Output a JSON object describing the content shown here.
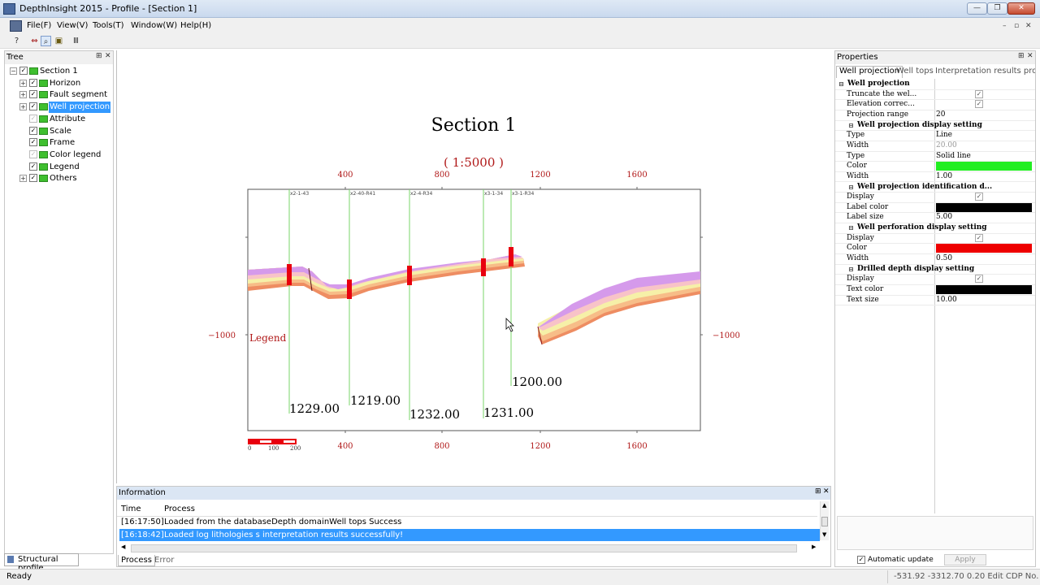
{
  "window": {
    "title": "DepthInsight 2015 - Profile - [Section 1]",
    "controls": [
      "—",
      "❐",
      "✕"
    ]
  },
  "menu": [
    {
      "label": "File(F)"
    },
    {
      "label": "View(V)"
    },
    {
      "label": "Tools(T)"
    },
    {
      "label": "Window(W)"
    },
    {
      "label": "Help(H)"
    }
  ],
  "mdi_controls": [
    "–",
    "▫",
    "✕"
  ],
  "toolbar": [
    "?",
    "⇔",
    "⌕",
    "▣",
    "Ⅲ"
  ],
  "tree": {
    "title": "Tree",
    "pin": "⊞",
    "close": "✕",
    "items": [
      {
        "label": "Section 1",
        "level": 0,
        "expander": "−",
        "checked": true,
        "faded": false
      },
      {
        "label": "Horizon",
        "level": 1,
        "expander": "+",
        "checked": true,
        "faded": false
      },
      {
        "label": "Fault segment",
        "level": 1,
        "expander": "+",
        "checked": true,
        "faded": false
      },
      {
        "label": "Well projection",
        "level": 1,
        "expander": "+",
        "checked": true,
        "faded": false,
        "selected": true
      },
      {
        "label": "Attribute",
        "level": 1,
        "expander": "",
        "checked": true,
        "faded": true
      },
      {
        "label": "Scale",
        "level": 1,
        "expander": "",
        "checked": true,
        "faded": false
      },
      {
        "label": "Frame",
        "level": 1,
        "expander": "",
        "checked": true,
        "faded": false
      },
      {
        "label": "Color legend",
        "level": 1,
        "expander": "",
        "checked": true,
        "faded": true
      },
      {
        "label": "Legend",
        "level": 1,
        "expander": "",
        "checked": true,
        "faded": false
      },
      {
        "label": "Others",
        "level": 1,
        "expander": "+",
        "checked": true,
        "faded": false
      }
    ],
    "tab_label": "Structural profile"
  },
  "profile": {
    "title": "Section 1",
    "scale_label": "( 1:5000 )",
    "x_ticks": [
      "400",
      "800",
      "1200",
      "1600"
    ],
    "y_tick": "−1000",
    "legend_label": "Legend",
    "scalebar_labels": [
      "0",
      "100",
      "200"
    ],
    "wells": [
      {
        "name": "x2-1-43",
        "depth": "1229.00"
      },
      {
        "name": "x2-40-R41",
        "depth": "1219.00"
      },
      {
        "name": "x2-4-R34",
        "depth": "1232.00"
      },
      {
        "name": "x3-1-34",
        "depth": "1231.00"
      },
      {
        "name": "x3-1-R34",
        "depth": "1200.00"
      }
    ],
    "colors": {
      "layer_top": "#d59aeb",
      "layer_upper": "#f8c3c8",
      "layer_mid": "#f6f0a8",
      "layer_lower": "#f7bd88",
      "layer_base": "#ee8d62",
      "well_line": "#7ad66a",
      "perforation": "#e8000e",
      "axis_text": "#b01818"
    }
  },
  "information": {
    "title": "Information",
    "pin": "⊞",
    "close": "✕",
    "columns": [
      "Time",
      "Process"
    ],
    "rows": [
      {
        "time": "[16:17:50]",
        "process": "Loaded from the databaseDepth domainWell tops Success",
        "selected": false
      },
      {
        "time": "[16:18:42]",
        "process": "Loaded log lithologies s interpretation results successfully!",
        "selected": true
      }
    ],
    "tabs": [
      "Process",
      "Error"
    ]
  },
  "properties": {
    "title": "Properties",
    "pin": "⊞",
    "close": "✕",
    "tabs": [
      "Well projection",
      "Well tops",
      "Interpretation results pro..."
    ],
    "rows": [
      {
        "type": "group",
        "name": "Well projection"
      },
      {
        "type": "check",
        "name": "Truncate the wel...",
        "value": "✓"
      },
      {
        "type": "check",
        "name": "Elevation correc...",
        "value": "✓"
      },
      {
        "type": "text",
        "name": "Projection range",
        "value": "20"
      },
      {
        "type": "group",
        "name": "Well projection display setting"
      },
      {
        "type": "text",
        "name": "Type",
        "value": "Line"
      },
      {
        "type": "text",
        "name": "Width",
        "value": "20.00",
        "disabled": true
      },
      {
        "type": "text",
        "name": "Type",
        "value": "Solid line"
      },
      {
        "type": "color",
        "name": "Color",
        "value": "#22ee22"
      },
      {
        "type": "text",
        "name": "Width",
        "value": "1.00"
      },
      {
        "type": "group",
        "name": "Well projection identification d..."
      },
      {
        "type": "check",
        "name": "Display",
        "value": "✓"
      },
      {
        "type": "color",
        "name": "Label color",
        "value": "#000000"
      },
      {
        "type": "text",
        "name": "Label size",
        "value": "5.00"
      },
      {
        "type": "group",
        "name": "Well perforation display setting"
      },
      {
        "type": "check",
        "name": "Display",
        "value": "✓"
      },
      {
        "type": "color",
        "name": "Color",
        "value": "#ee0000"
      },
      {
        "type": "text",
        "name": "Width",
        "value": "0.50"
      },
      {
        "type": "group",
        "name": "Drilled depth display setting"
      },
      {
        "type": "check",
        "name": "Display",
        "value": "✓"
      },
      {
        "type": "color",
        "name": "Text color",
        "value": "#000000"
      },
      {
        "type": "text",
        "name": "Text size",
        "value": "10.00"
      }
    ],
    "auto_update_label": "Automatic update",
    "auto_update_checked": "✓",
    "apply_label": "Apply"
  },
  "status": {
    "left": "Ready",
    "right": "-531.92 -3312.70 0.20 Edit CDP No."
  }
}
